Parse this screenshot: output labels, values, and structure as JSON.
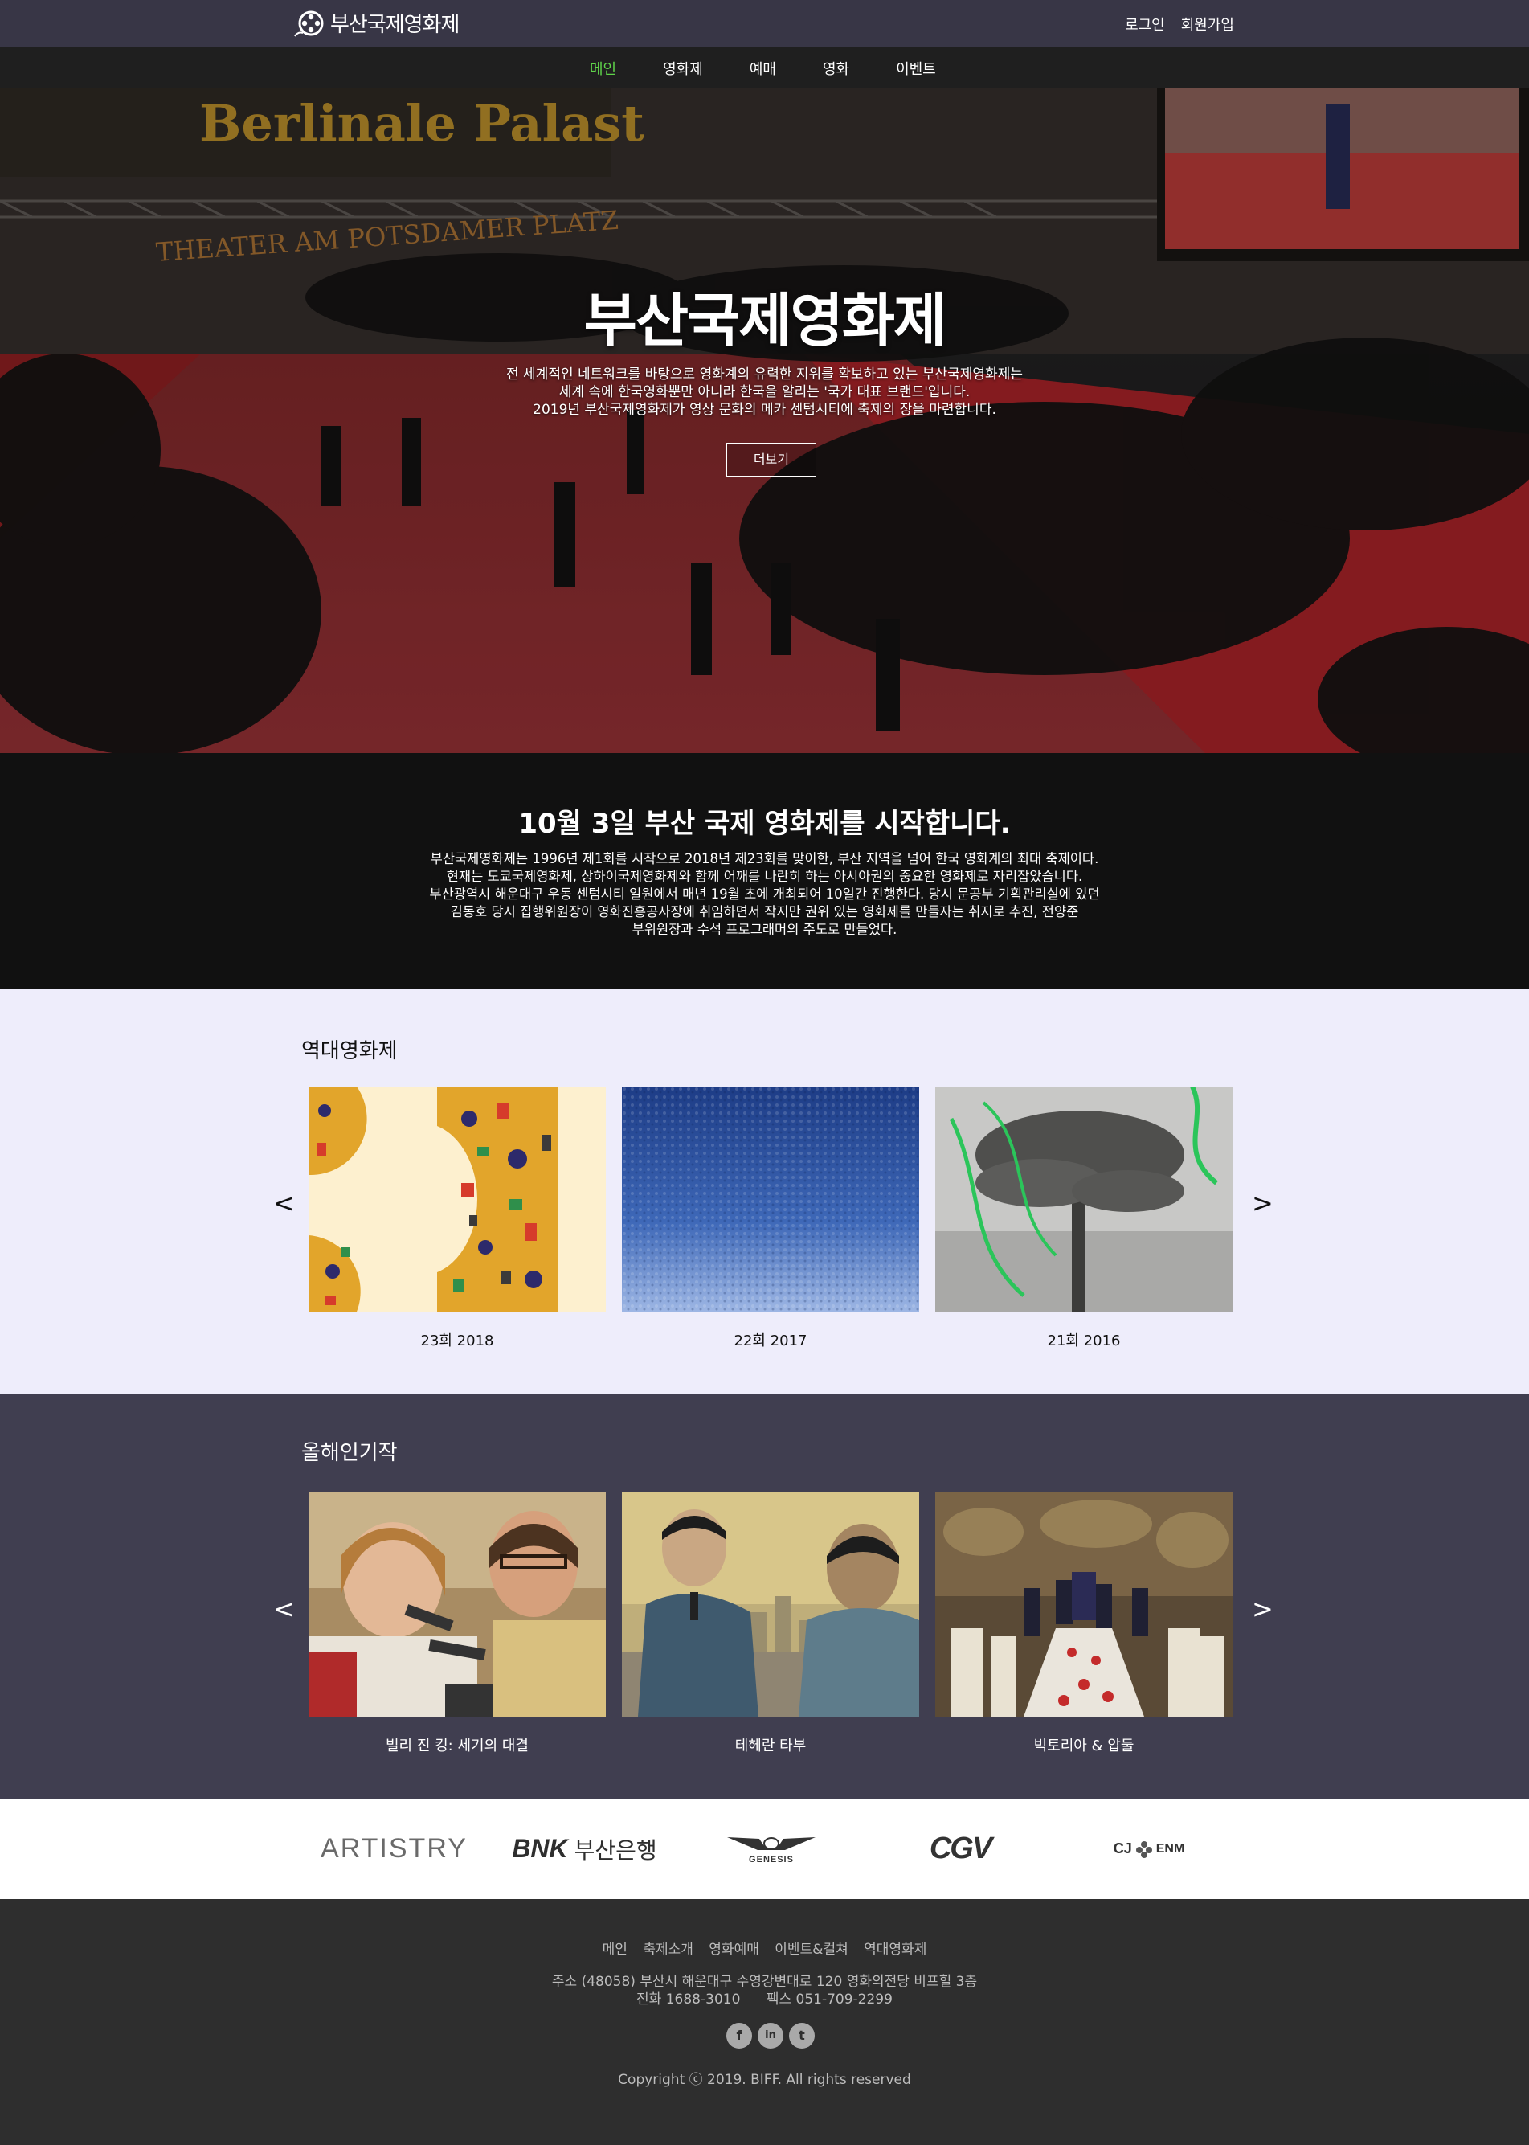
{
  "header": {
    "logo_text": "부산국제영화제",
    "login": "로그인",
    "signup": "회원가입"
  },
  "nav": {
    "items": [
      "메인",
      "영화제",
      "예매",
      "영화",
      "이벤트"
    ],
    "active_color": "#5fd34a"
  },
  "hero": {
    "title": "부산국제영화제",
    "desc_line1": "전 세계적인 네트워크를 바탕으로 영화계의 유력한 지위를 확보하고 있는 부산국제영화제는",
    "desc_line2": "세계 속에 한국영화뿐만 아니라 한국을 알리는 '국가 대표 브랜드'입니다.",
    "desc_line3": "2019년 부산국제영화제가 영상 문화의 메카 센텀시티에 축제의 장을 마련합니다.",
    "button": "더보기",
    "sign_top": "Berlinale Palast",
    "sign_arch": "THEATER AM POTSDAMER PLATZ"
  },
  "intro": {
    "heading": "10월 3일 부산 국제 영화제를 시작합니다.",
    "line1": "부산국제영화제는 1996년 제1회를 시작으로 2018년 제23회를 맞이한, 부산 지역을 넘어 한국 영화계의 최대 축제이다.",
    "line2": "현재는 도쿄국제영화제, 상하이국제영화제와 함께 어깨를 나란히 하는 아시아권의 중요한 영화제로 자리잡았습니다.",
    "line3": "부산광역시 해운대구 우동 센텀시티 일원에서 매년 19월 초에 개최되어 10일간 진행한다. 당시 문공부 기획관리실에 있던",
    "line4": "김동호 당시 집행위원장이 영화진흥공사장에 취임하면서 작지만 권위 있는 영화제를 만들자는 취지로 추진, 전양준",
    "line5": "부위원장과 수석 프로그래머의 주도로 만들었다."
  },
  "past": {
    "title": "역대영화제",
    "prev": "<",
    "next": ">",
    "cards": [
      "23회 2018",
      "22회 2017",
      "21회 2016"
    ]
  },
  "highlights": {
    "title": "올해인기작",
    "prev": "<",
    "next": ">",
    "cards": [
      "빌리 진 킹: 세기의 대결",
      "테헤란 타부",
      "빅토리아 & 압둘"
    ]
  },
  "sponsors": {
    "artistry": "ARTISTRY",
    "bnk_mark": "BNK",
    "bnk_name": "부산은행",
    "genesis": "GENESIS",
    "cgv": "CGV",
    "cj_mark": "CJ",
    "cj_name": "ENM"
  },
  "footer": {
    "links": [
      "메인",
      "축제소개",
      "영화예매",
      "이벤트&컬쳐",
      "역대영화제"
    ],
    "address": "주소 (48058) 부산시 해운대구 수영강변대로 120 영화의전당 비프힐 3층",
    "phone": "전화 1688-3010      팩스 051-709-2299",
    "social": [
      "f",
      "in",
      "t"
    ],
    "copyright": "Copyright ⓒ 2019. BIFF. All rights reserved"
  }
}
